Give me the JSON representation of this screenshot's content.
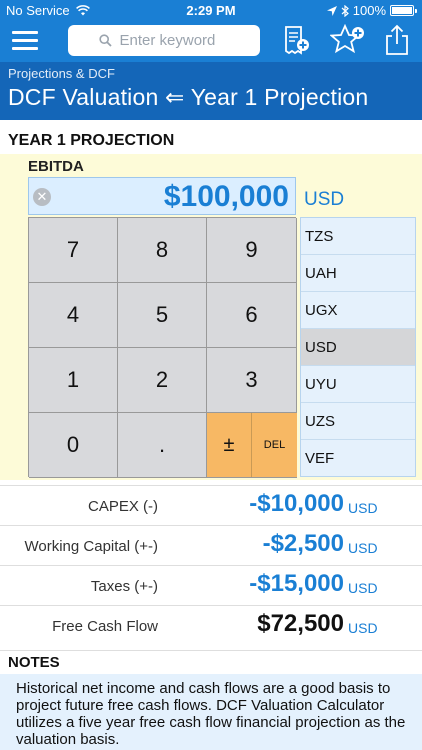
{
  "status_bar": {
    "carrier": "No Service",
    "time": "2:29 PM",
    "battery": "100%"
  },
  "toolbar": {
    "search_placeholder": "Enter keyword",
    "icons": [
      "menu-icon",
      "search-icon",
      "add-note-icon",
      "add-favorite-icon",
      "share-icon"
    ]
  },
  "header": {
    "breadcrumb": "Projections & DCF",
    "title": "DCF Valuation ⇐ Year 1 Projection"
  },
  "section": {
    "title": "YEAR 1 PROJECTION"
  },
  "input": {
    "label": "EBITDA",
    "value": "$100,000",
    "unit": "USD"
  },
  "keypad": {
    "keys": [
      "7",
      "8",
      "9",
      "4",
      "5",
      "6",
      "1",
      "2",
      "3",
      "0",
      "."
    ],
    "plus_minus": "±",
    "delete": "DEL"
  },
  "currency_picker": {
    "items": [
      "TZS",
      "UAH",
      "UGX",
      "USD",
      "UYU",
      "UZS",
      "VEF"
    ],
    "selected": "USD"
  },
  "results": [
    {
      "label": "CAPEX (-)",
      "value": "-$10,000",
      "unit": "USD"
    },
    {
      "label": "Working Capital (+-)",
      "value": "-$2,500",
      "unit": "USD"
    },
    {
      "label": "Taxes  (+-)",
      "value": "-$15,000",
      "unit": "USD"
    },
    {
      "label": "Free Cash Flow",
      "value": "$72,500",
      "unit": "USD"
    }
  ],
  "notes": {
    "title": "NOTES",
    "text": "Historical net income and cash flows are a good basis to project future free cash flows. DCF Valuation Calculator utilizes a five year free cash flow financial projection as the valuation basis."
  },
  "colors": {
    "toolbar": "#1a7fd4",
    "title_band": "#1466b8",
    "accent": "#1a7fd4",
    "keypad_orange": "#f7b864"
  }
}
